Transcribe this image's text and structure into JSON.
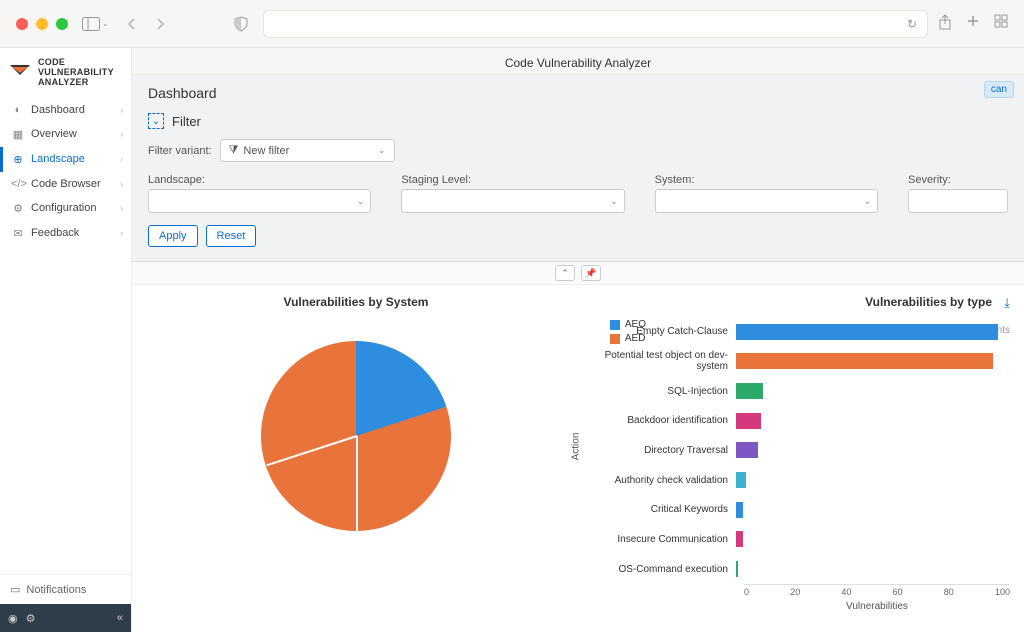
{
  "browser": {
    "reload": "↻"
  },
  "app": {
    "title": "Code Vulnerability Analyzer",
    "logo_lines": [
      "CODE",
      "VULNERABILITY",
      "ANALYZER"
    ]
  },
  "sidebar": {
    "items": [
      {
        "icon": "◐",
        "label": "Dashboard"
      },
      {
        "icon": "▦",
        "label": "Overview"
      },
      {
        "icon": "⊕",
        "label": "Landscape"
      },
      {
        "icon": "</>",
        "label": "Code Browser"
      },
      {
        "icon": "⚙",
        "label": "Configuration"
      },
      {
        "icon": "✉",
        "label": "Feedback"
      }
    ],
    "notifications": "Notifications"
  },
  "page": {
    "title": "Dashboard",
    "can_btn": "can"
  },
  "filter": {
    "title": "Filter",
    "variant_label": "Filter variant:",
    "variant_value": "New filter",
    "fields": {
      "landscape": "Landscape:",
      "staging": "Staging Level:",
      "system": "System:",
      "severity": "Severity:"
    },
    "apply": "Apply",
    "reset": "Reset"
  },
  "chart_data": [
    {
      "type": "pie",
      "title": "Vulnerabilities by System",
      "series": [
        {
          "name": "AEQ",
          "value": 20,
          "color": "#2e8ddf"
        },
        {
          "name": "AED",
          "value": 80,
          "color": "#e8743b"
        }
      ]
    },
    {
      "type": "bar",
      "title": "Vulnerabilities by type",
      "xlabel": "Vulnerabilities",
      "ylabel": "Action",
      "xlim": [
        0,
        110
      ],
      "xticks": [
        0,
        20,
        40,
        60,
        80,
        100
      ],
      "categories": [
        "Empty Catch-Clause",
        "Potential test object on dev-system",
        "SQL-Injection",
        "Backdoor identification",
        "Directory Traversal",
        "Authority check validation",
        "Critical Keywords",
        "Insecure Communication",
        "OS-Command execution"
      ],
      "values": [
        105,
        103,
        11,
        10,
        9,
        4,
        3,
        3,
        1
      ],
      "colors": [
        "#2e8ddf",
        "#e8743b",
        "#2ca96b",
        "#d4397d",
        "#7e57c2",
        "#3fb1ce",
        "#2e8ddf",
        "#d4397d",
        "#2ca96b"
      ]
    }
  ]
}
